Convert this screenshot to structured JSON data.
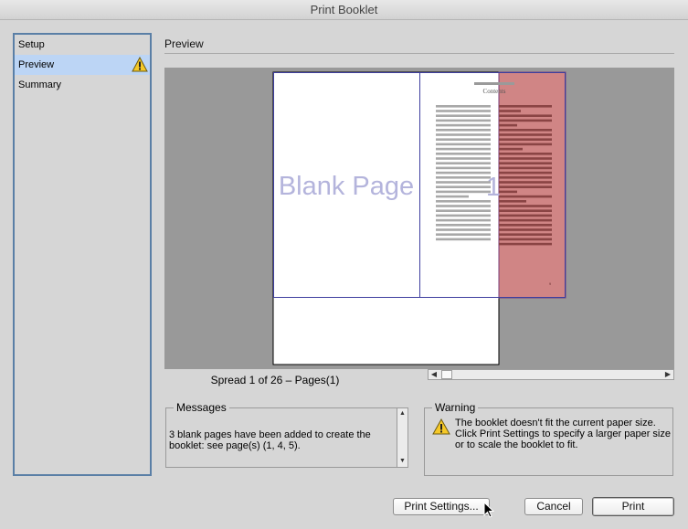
{
  "window": {
    "title": "Print Booklet"
  },
  "sidebar": {
    "items": [
      {
        "label": "Setup"
      },
      {
        "label": "Preview",
        "selected": true,
        "icon": "warning-icon"
      },
      {
        "label": "Summary"
      }
    ]
  },
  "panel": {
    "title": "Preview"
  },
  "preview": {
    "blank_page_label": "Blank Page",
    "page_number": "1",
    "contents_heading": "Contents",
    "footer_number": "9"
  },
  "spread": {
    "label": "Spread 1 of 26 – Pages(1)"
  },
  "messages": {
    "legend": "Messages",
    "text": "3 blank pages have been added to create the booklet: see page(s) (1, 4, 5)."
  },
  "warning": {
    "legend": "Warning",
    "text": "The booklet doesn't fit the current paper size. Click Print Settings to specify a larger paper size or to scale the booklet to fit.",
    "icon": "warning-icon"
  },
  "buttons": {
    "print_settings": "Print Settings...",
    "cancel": "Cancel",
    "print": "Print"
  },
  "colors": {
    "selection": "#bcd5f5",
    "sidebar_border": "#5a7fa6",
    "overflow_red": "#d08585",
    "page_outline": "#3e3e9e",
    "blank_label": "#b4b4dc"
  }
}
